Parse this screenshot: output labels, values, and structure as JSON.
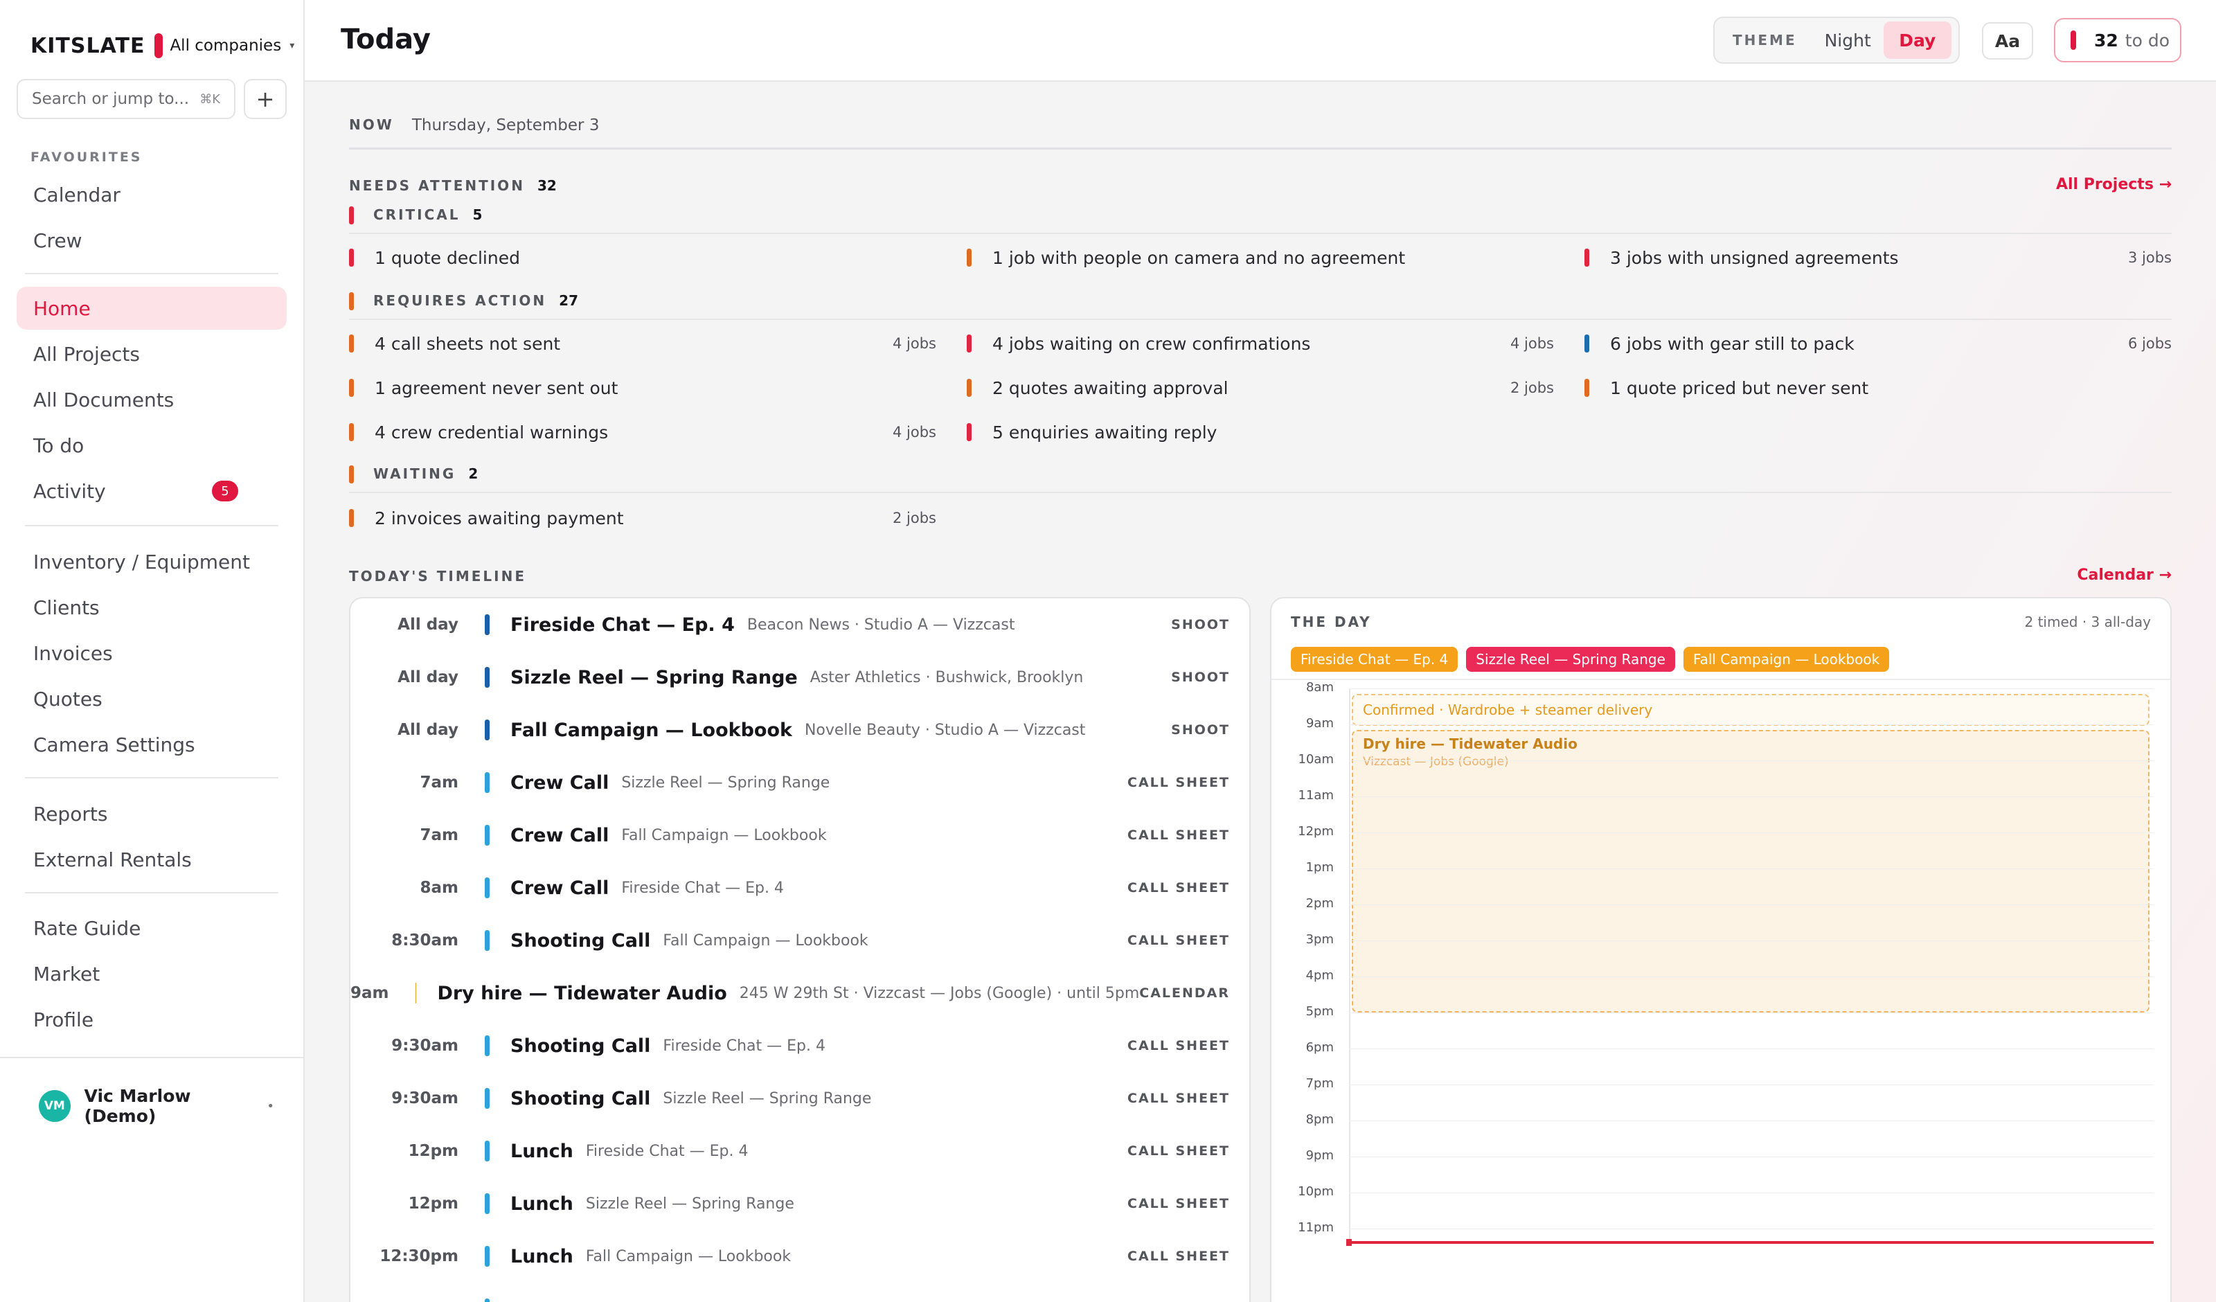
{
  "app": {
    "brand": "KITSLATE",
    "company": "All companies",
    "caret": "▾"
  },
  "search": {
    "placeholder": "Search or jump to...",
    "shortcut": "⌘K",
    "plus": "+"
  },
  "sidebar": {
    "favourites_label": "FAVOURITES",
    "favourites": [
      {
        "label": "Calendar"
      },
      {
        "label": "Crew"
      }
    ],
    "main_nav": [
      {
        "label": "Home",
        "active": true
      },
      {
        "label": "All Projects"
      },
      {
        "label": "All Documents"
      },
      {
        "label": "To do"
      },
      {
        "label": "Activity",
        "badge": "5"
      }
    ],
    "resources": [
      {
        "label": "Inventory / Equipment"
      },
      {
        "label": "Clients"
      },
      {
        "label": "Invoices"
      },
      {
        "label": "Quotes"
      },
      {
        "label": "Camera Settings"
      }
    ],
    "reports": [
      {
        "label": "Reports"
      },
      {
        "label": "External Rentals"
      }
    ],
    "other": [
      {
        "label": "Rate Guide"
      },
      {
        "label": "Market"
      },
      {
        "label": "Profile"
      }
    ],
    "user": {
      "initials": "VM",
      "name": "Vic Marlow (Demo)",
      "menu": "•"
    }
  },
  "header": {
    "title": "Today",
    "theme_label": "THEME",
    "theme_options": [
      "Night",
      "Day"
    ],
    "theme_selected": "Day",
    "font_button": "Aa",
    "todo_count": "32",
    "todo_label": "to do"
  },
  "now": {
    "label": "NOW",
    "date": "Thursday, September 3"
  },
  "needs_attention": {
    "label": "NEEDS ATTENTION",
    "count": "32",
    "link": "All Projects →",
    "groups": [
      {
        "label": "CRITICAL",
        "count": "5",
        "color": "#e0263c",
        "items": [
          {
            "text": "1 quote declined",
            "jobs": "",
            "color": "#e0263c"
          },
          {
            "text": "1 job with people on camera and no agreement",
            "jobs": "",
            "color": "#e06b1f"
          },
          {
            "text": "3 jobs with unsigned agreements",
            "jobs": "3 jobs",
            "color": "#e0263c"
          }
        ]
      },
      {
        "label": "REQUIRES ACTION",
        "count": "27",
        "color": "#e06b1f",
        "items": [
          {
            "text": "4 call sheets not sent",
            "jobs": "4 jobs",
            "color": "#e06b1f"
          },
          {
            "text": "4 jobs waiting on crew confirmations",
            "jobs": "4 jobs",
            "color": "#e0263c"
          },
          {
            "text": "6 jobs with gear still to pack",
            "jobs": "6 jobs",
            "color": "#1b6fb0"
          },
          {
            "text": "1 agreement never sent out",
            "jobs": "",
            "color": "#e06b1f"
          },
          {
            "text": "2 quotes awaiting approval",
            "jobs": "2 jobs",
            "color": "#e06b1f"
          },
          {
            "text": "1 quote priced but never sent",
            "jobs": "",
            "color": "#e06b1f"
          },
          {
            "text": "4 crew credential warnings",
            "jobs": "4 jobs",
            "color": "#e06b1f"
          },
          {
            "text": "5 enquiries awaiting reply",
            "jobs": "",
            "color": "#e0263c"
          }
        ]
      },
      {
        "label": "WAITING",
        "count": "2",
        "color": "#e06b1f",
        "items": [
          {
            "text": "2 invoices awaiting payment",
            "jobs": "2 jobs",
            "color": "#e06b1f"
          }
        ]
      }
    ]
  },
  "timeline": {
    "label": "TODAY'S TIMELINE",
    "link": "Calendar →",
    "rows": [
      {
        "time": "All day",
        "title": "Fireside Chat — Ep. 4",
        "sub": "Beacon News · Studio A — Vizzcast",
        "type": "SHOOT",
        "color": "#1b5fa8"
      },
      {
        "time": "All day",
        "title": "Sizzle Reel — Spring Range",
        "sub": "Aster Athletics · Bushwick, Brooklyn",
        "type": "SHOOT",
        "color": "#1b5fa8"
      },
      {
        "time": "All day",
        "title": "Fall Campaign — Lookbook",
        "sub": "Novelle Beauty · Studio A — Vizzcast",
        "type": "SHOOT",
        "color": "#1b5fa8"
      },
      {
        "time": "7am",
        "title": "Crew Call",
        "sub": "Sizzle Reel — Spring Range",
        "type": "CALL SHEET",
        "color": "#2aa3d8"
      },
      {
        "time": "7am",
        "title": "Crew Call",
        "sub": "Fall Campaign — Lookbook",
        "type": "CALL SHEET",
        "color": "#2aa3d8"
      },
      {
        "time": "8am",
        "title": "Crew Call",
        "sub": "Fireside Chat — Ep. 4",
        "type": "CALL SHEET",
        "color": "#2aa3d8"
      },
      {
        "time": "8:30am",
        "title": "Shooting Call",
        "sub": "Fall Campaign — Lookbook",
        "type": "CALL SHEET",
        "color": "#2aa3d8"
      },
      {
        "time": "9am",
        "title": "Dry hire — Tidewater Audio",
        "sub": "245 W 29th St · Vizzcast — Jobs (Google) · until 5pm",
        "type": "CALENDAR",
        "color": "#e4a21b"
      },
      {
        "time": "9:30am",
        "title": "Shooting Call",
        "sub": "Fireside Chat — Ep. 4",
        "type": "CALL SHEET",
        "color": "#2aa3d8"
      },
      {
        "time": "9:30am",
        "title": "Shooting Call",
        "sub": "Sizzle Reel — Spring Range",
        "type": "CALL SHEET",
        "color": "#2aa3d8"
      },
      {
        "time": "12pm",
        "title": "Lunch",
        "sub": "Fireside Chat — Ep. 4",
        "type": "CALL SHEET",
        "color": "#2aa3d8"
      },
      {
        "time": "12pm",
        "title": "Lunch",
        "sub": "Sizzle Reel — Spring Range",
        "type": "CALL SHEET",
        "color": "#2aa3d8"
      },
      {
        "time": "12:30pm",
        "title": "Lunch",
        "sub": "Fall Campaign — Lookbook",
        "type": "CALL SHEET",
        "color": "#2aa3d8"
      }
    ]
  },
  "the_day": {
    "label": "THE DAY",
    "meta": "2 timed · 3 all-day",
    "chips": [
      {
        "label": "Fireside Chat — Ep. 4",
        "color": "#f5a21a"
      },
      {
        "label": "Sizzle Reel — Spring Range",
        "color": "#ec2a57"
      },
      {
        "label": "Fall Campaign — Lookbook",
        "color": "#f5a21a"
      }
    ],
    "hours": [
      "8am",
      "9am",
      "10am",
      "11am",
      "12pm",
      "1pm",
      "2pm",
      "3pm",
      "4pm",
      "5pm",
      "6pm",
      "7pm",
      "8pm",
      "9pm",
      "10pm",
      "11pm"
    ],
    "confirmed_event": "Confirmed · Wardrobe + steamer delivery",
    "dry_hire_title": "Dry hire — Tidewater Audio",
    "dry_hire_sub": "Vizzcast — Jobs (Google)"
  }
}
